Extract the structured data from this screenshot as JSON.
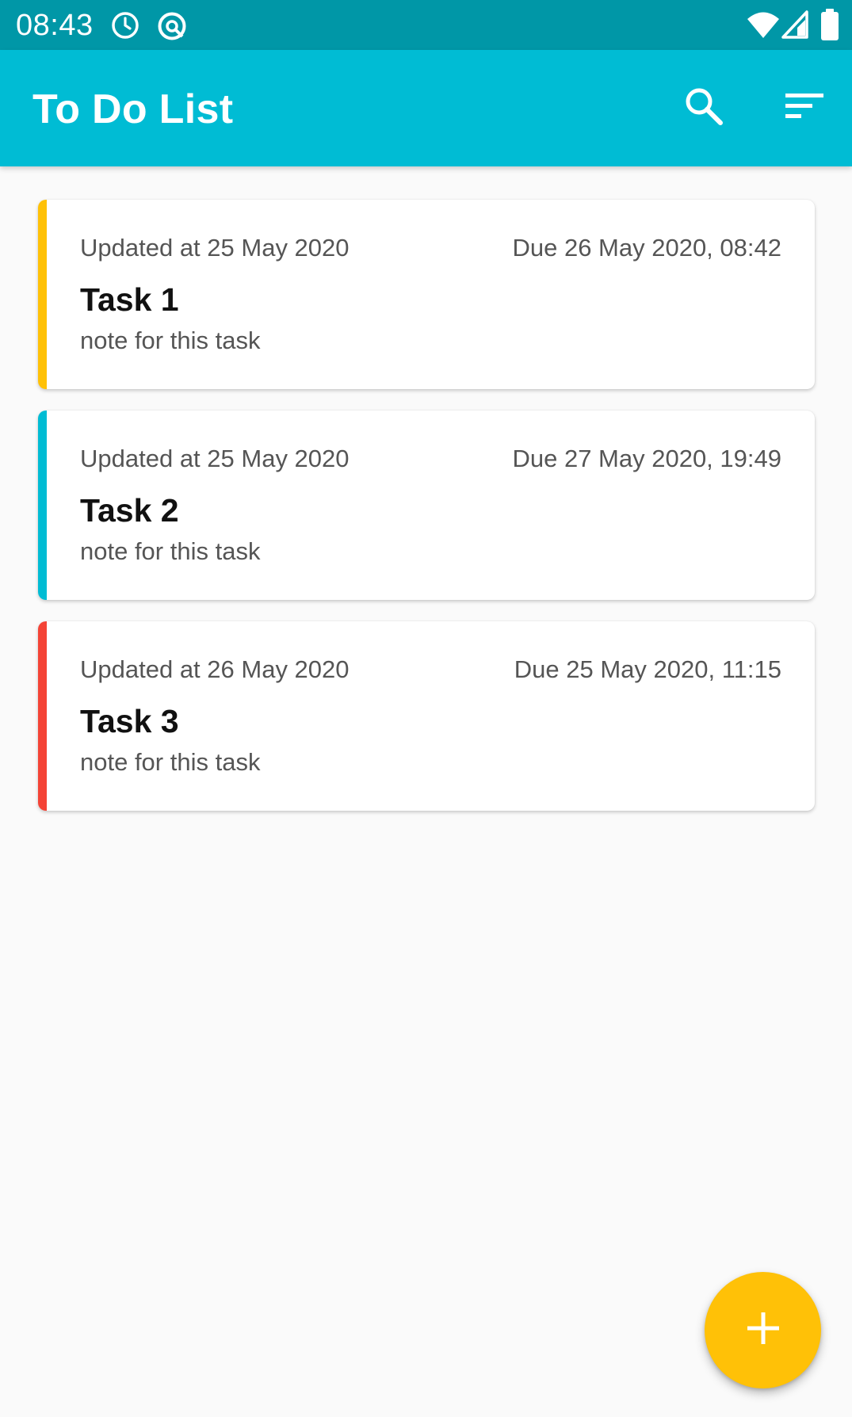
{
  "status_bar": {
    "time": "08:43",
    "icons": [
      "alarm-icon",
      "data-saver-icon",
      "wifi-icon",
      "cellular-signal-icon",
      "battery-icon"
    ]
  },
  "app_bar": {
    "title": "To Do List",
    "actions": [
      "search-icon",
      "sort-icon"
    ],
    "color": "#00bcd4"
  },
  "tasks": [
    {
      "updated": "Updated at 25 May 2020",
      "due": "Due 26 May 2020, 08:42",
      "title": "Task 1",
      "note": "note for this task",
      "color": "#ffc107"
    },
    {
      "updated": "Updated at 25 May 2020",
      "due": "Due 27 May 2020, 19:49",
      "title": "Task 2",
      "note": "note for this task",
      "color": "#00bcd4"
    },
    {
      "updated": "Updated at 26 May 2020",
      "due": "Due 25 May 2020, 11:15",
      "title": "Task 3",
      "note": "note for this task",
      "color": "#f44336"
    }
  ],
  "fab": {
    "icon": "plus-icon",
    "color": "#ffc107"
  }
}
